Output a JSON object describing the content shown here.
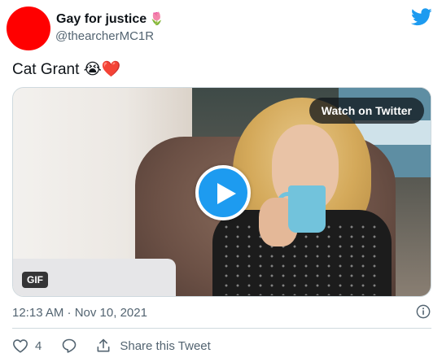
{
  "author": {
    "display_name": "Gay for justice",
    "name_emoji": "🌷",
    "handle": "@thearcherMC1R",
    "avatar_color": "#ff0000"
  },
  "tweet": {
    "text": "Cat Grant",
    "emojis": "😭❤️"
  },
  "media": {
    "watch_label": "Watch on Twitter",
    "badge": "GIF"
  },
  "meta": {
    "timestamp": "12:13 AM · Nov 10, 2021"
  },
  "actions": {
    "like_count": "4",
    "share_label": "Share this Tweet"
  },
  "colors": {
    "accent": "#1d9bf0",
    "text_secondary": "#536471",
    "border": "#cfd9de"
  },
  "icons": [
    "twitter-bird-icon",
    "play-icon",
    "info-icon",
    "heart-icon",
    "reply-icon",
    "share-icon"
  ]
}
